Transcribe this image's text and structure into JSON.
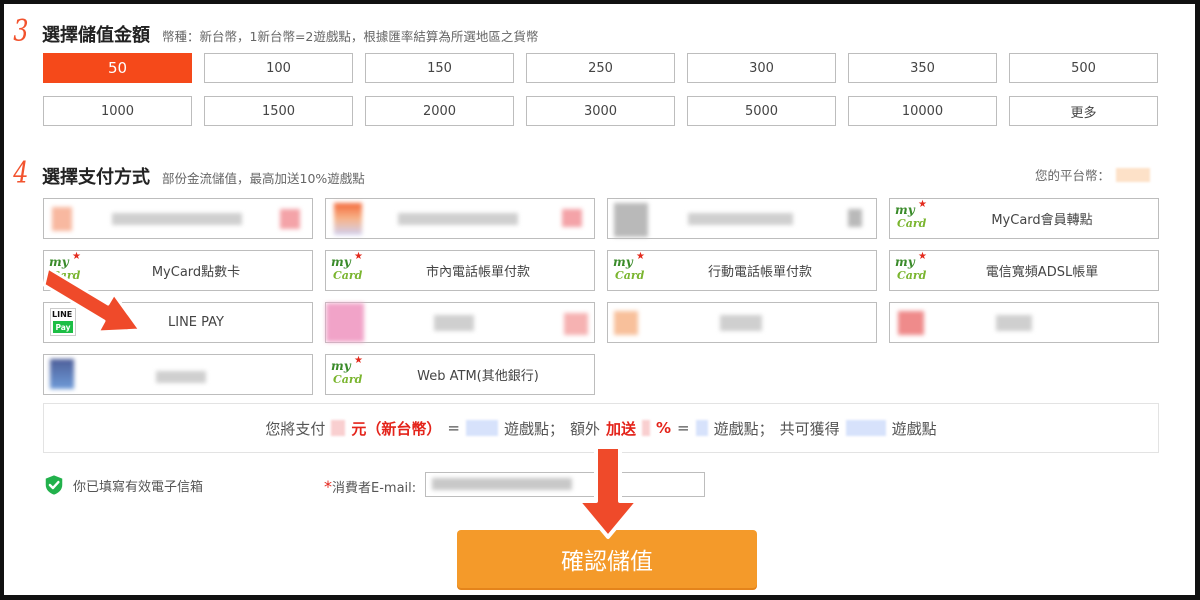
{
  "step3": {
    "number": "3",
    "title": "選擇儲值金額",
    "note": "幣種：新台幣，1新台幣=2遊戲點，根據匯率結算為所選地區之貨幣"
  },
  "amounts": [
    {
      "label": "50",
      "selected": true
    },
    {
      "label": "100"
    },
    {
      "label": "150"
    },
    {
      "label": "250"
    },
    {
      "label": "300"
    },
    {
      "label": "350"
    },
    {
      "label": "500"
    },
    {
      "label": "1000"
    },
    {
      "label": "1500"
    },
    {
      "label": "2000"
    },
    {
      "label": "3000"
    },
    {
      "label": "5000"
    },
    {
      "label": "10000"
    },
    {
      "label": "更多"
    }
  ],
  "step4": {
    "number": "4",
    "title": "選擇支付方式",
    "note": "部份金流儲值，最高加送10%遊戲點"
  },
  "balance_label": "您的平台幣：",
  "payments": {
    "mycard_transfer": "MyCard會員轉點",
    "mycard_card": "MyCard點數卡",
    "landline": "市內電話帳單付款",
    "mobile": "行動電話帳單付款",
    "adsl": "電信寬頻ADSL帳單",
    "linepay": "LINE PAY",
    "webatm": "Web ATM(其他銀行)"
  },
  "linepay_logo": {
    "line": "LINE",
    "pay": "Pay"
  },
  "mycard_logo": {
    "my": "my",
    "card": "Card",
    "star": "★"
  },
  "summary": {
    "part1": "您將支付",
    "part2": "元（新台幣）",
    "part3": "=",
    "part4": "遊戲點；",
    "part5": "額外",
    "part6": "加送",
    "part7": "%",
    "part8": "=",
    "part9": "遊戲點；",
    "part10": "共可獲得",
    "part11": "遊戲點"
  },
  "email": {
    "valid_text": "你已填寫有效電子信箱",
    "required_mark": "*",
    "label": "消費者E-mail:"
  },
  "confirm_label": "確認儲值",
  "colors": {
    "accent": "#f5491a",
    "confirm": "#f49a2a",
    "check": "#22b14c",
    "arrow": "#ef4a2a"
  }
}
